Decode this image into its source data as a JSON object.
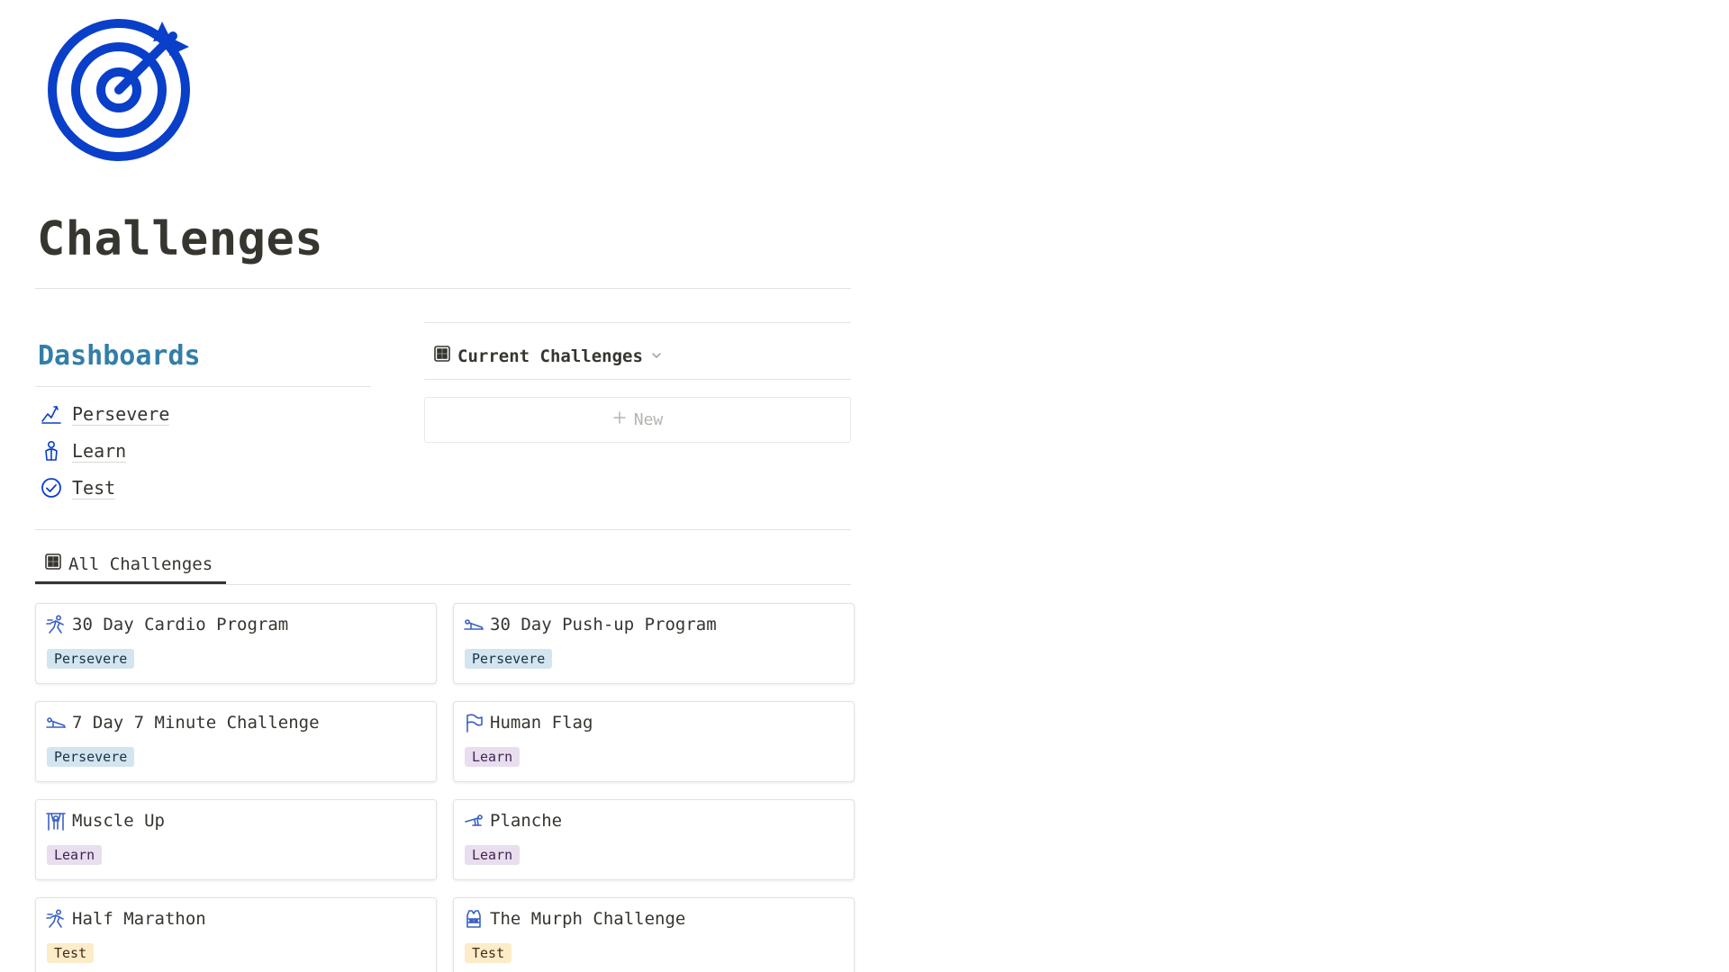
{
  "page": {
    "title": "Challenges",
    "icon": "target-icon"
  },
  "dashboards": {
    "heading": "Dashboards",
    "items": [
      {
        "label": "Persevere",
        "icon": "chart-line-icon"
      },
      {
        "label": "Learn",
        "icon": "person-icon"
      },
      {
        "label": "Test",
        "icon": "check-circle-icon"
      }
    ]
  },
  "current_view": {
    "label": "Current Challenges",
    "icon": "table-icon",
    "dropdown_icon": "chevron-down-icon",
    "new_label": "New"
  },
  "all_view": {
    "label": "All Challenges",
    "icon": "table-icon"
  },
  "cards": [
    {
      "title": "30 Day Cardio Program",
      "tag": "Persevere",
      "tag_type": "persevere",
      "icon": "runner-icon"
    },
    {
      "title": "30 Day Push-up Program",
      "tag": "Persevere",
      "tag_type": "persevere",
      "icon": "pushup-icon"
    },
    {
      "title": "7 Day 7 Minute Challenge",
      "tag": "Persevere",
      "tag_type": "persevere",
      "icon": "pushup-icon"
    },
    {
      "title": "Human Flag",
      "tag": "Learn",
      "tag_type": "learn",
      "icon": "flag-icon"
    },
    {
      "title": "Muscle Up",
      "tag": "Learn",
      "tag_type": "learn",
      "icon": "pullup-icon"
    },
    {
      "title": "Planche",
      "tag": "Learn",
      "tag_type": "learn",
      "icon": "planche-icon"
    },
    {
      "title": "Half Marathon",
      "tag": "Test",
      "tag_type": "test",
      "icon": "runner-icon"
    },
    {
      "title": "The Murph Challenge",
      "tag": "Test",
      "tag_type": "test",
      "icon": "vest-icon"
    }
  ],
  "colors": {
    "accent": "#0a3fc9",
    "heading_blue": "#337ea9",
    "tag_persevere": "#d3e5ef",
    "tag_learn": "#e8deee",
    "tag_test": "#fdecc8"
  }
}
